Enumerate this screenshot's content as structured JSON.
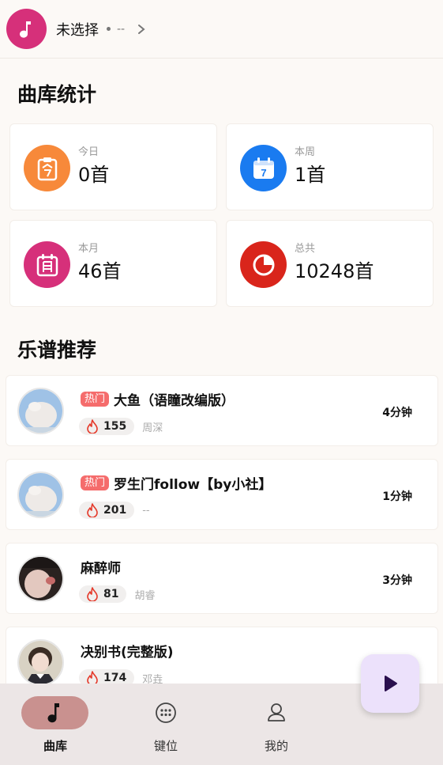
{
  "header": {
    "title": "未选择",
    "artist": "--"
  },
  "stats": {
    "title": "曲库统计",
    "cards": [
      {
        "label": "今日",
        "value": "0首",
        "icon": "today-icon",
        "color": "#f7893a"
      },
      {
        "label": "本周",
        "value": "1首",
        "icon": "week-calendar-icon",
        "color": "#1a7bf0"
      },
      {
        "label": "本月",
        "value": "46首",
        "icon": "month-calendar-icon",
        "color": "#d6307a"
      },
      {
        "label": "总共",
        "value": "10248首",
        "icon": "pie-chart-icon",
        "color": "#d9251b"
      }
    ]
  },
  "recommend": {
    "title": "乐谱推荐",
    "items": [
      {
        "hot": "热门",
        "name": "大鱼（语瞳改编版）",
        "plays": "155",
        "artist": "周深",
        "duration": "4分钟"
      },
      {
        "hot": "热门",
        "name": "罗生门follow【by小社】",
        "plays": "201",
        "artist": "--",
        "duration": "1分钟"
      },
      {
        "hot": "",
        "name": "麻醉师",
        "plays": "81",
        "artist": "胡睿",
        "duration": "3分钟"
      },
      {
        "hot": "",
        "name": "决别书(完整版)",
        "plays": "174",
        "artist": "邓垚",
        "duration": ""
      }
    ]
  },
  "nav": {
    "items": [
      {
        "label": "曲库",
        "icon": "music-note-icon",
        "active": true
      },
      {
        "label": "键位",
        "icon": "keypad-icon",
        "active": false
      },
      {
        "label": "我的",
        "icon": "profile-icon",
        "active": false
      }
    ]
  },
  "colors": {
    "accent": "#d6307a",
    "hot": "#f56c6c",
    "nav_active": "#c9918f",
    "fab": "#ece1fb"
  }
}
